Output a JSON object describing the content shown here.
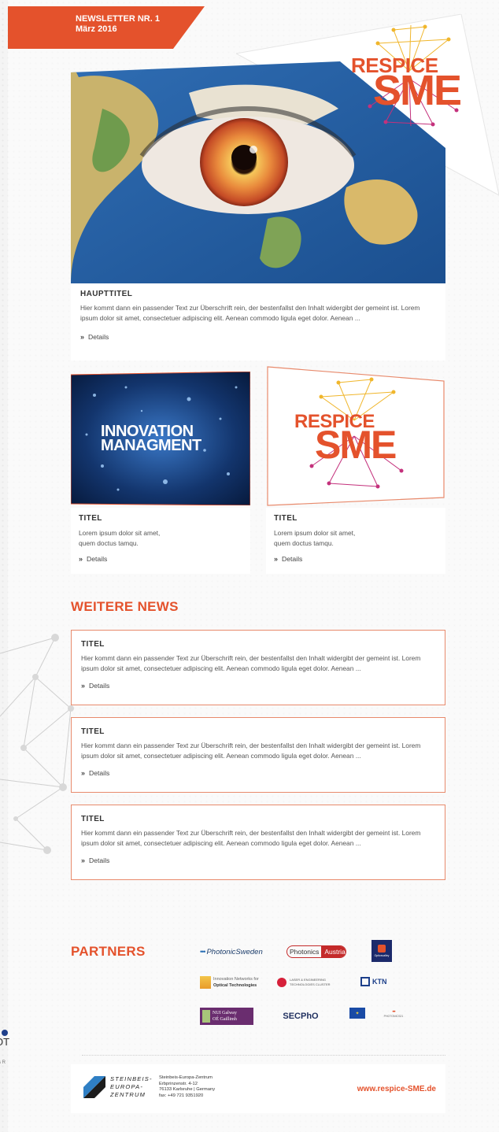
{
  "header": {
    "newsletter_label": "NEWSLETTER NR. 1",
    "date": "März 2016"
  },
  "brand": {
    "logo_line1": "RESPICE",
    "logo_line2": "SME",
    "accent_color": "#e4522c"
  },
  "hero": {
    "title": "HAUPTTITEL",
    "text": "Hier kommt dann ein passender Text zur Überschrift rein, der bestenfallst den Inhalt widergibt der gemeint ist. Lorem ipsum dolor sit amet, consectetuer adipiscing elit. Aenean commodo ligula eget dolor. Aenean ...",
    "details": "Details"
  },
  "features": [
    {
      "image_text_line1": "INNOVATION",
      "image_text_line2": "MANAGMENT",
      "title": "TITEL",
      "text_line1": "Lorem ipsum dolor sit amet,",
      "text_line2": "quem doctus tamqu.",
      "details": "Details"
    },
    {
      "title": "TITEL",
      "text_line1": "Lorem ipsum dolor sit amet,",
      "text_line2": "quem doctus tamqu.",
      "details": "Details"
    }
  ],
  "weitere_news": {
    "heading": "WEITERE NEWS",
    "items": [
      {
        "title": "TITEL",
        "text": "Hier kommt dann ein passender Text zur Überschrift rein, der bestenfallst den Inhalt widergibt der gemeint ist. Lorem ipsum dolor sit amet, consectetuer adipiscing elit. Aenean commodo ligula eget dolor. Aenean ...",
        "details": "Details"
      },
      {
        "title": "TITEL",
        "text": "Hier kommt dann ein passender Text zur Überschrift rein, der bestenfallst den Inhalt widergibt der gemeint ist. Lorem ipsum dolor sit amet, consectetuer adipiscing elit. Aenean commodo ligula eget dolor. Aenean ...",
        "details": "Details"
      },
      {
        "title": "TITEL",
        "text": "Hier kommt dann ein passender Text zur Überschrift rein, der bestenfallst den Inhalt widergibt der gemeint ist. Lorem ipsum dolor sit amet, consectetuer adipiscing elit. Aenean commodo ligula eget dolor. Aenean ...",
        "details": "Details"
      }
    ]
  },
  "partners": {
    "heading": "PARTNERS",
    "logos": {
      "photonic_sweden": "PhotonicSweden",
      "photonics_austria_1": "Photonics",
      "photonics_austria_2": "Austria",
      "optic_valley": "Opticsvalley",
      "optical_tech_1": "Innovation Networks for",
      "optical_tech_2": "Optical Technologies",
      "laser_cluster_1": "LASER & ENGINEERING",
      "laser_cluster_2": "TECHNOLOGIES CLUSTER",
      "ktn": "KTN",
      "nui_1": "NUI Galway",
      "nui_2": "OÉ Gaillimh",
      "secpho": "SECPhO",
      "photonics21": "PHOTONICS21"
    }
  },
  "footer": {
    "org_line1": "STEINBEIS-",
    "org_line2": "EUROPA-",
    "org_line3": "ZENTRUM",
    "address_line1": "Steinbeis-Europa-Zentrum",
    "address_line2": "Erbprinzenstr. 4-12",
    "address_line3": "76133 Karlsruhe | Germany",
    "address_line4": "fax: +49 721 9351920",
    "website": "www.respice-SME.de"
  },
  "side_fragment": {
    "letters": "OT",
    "small": "s R"
  }
}
